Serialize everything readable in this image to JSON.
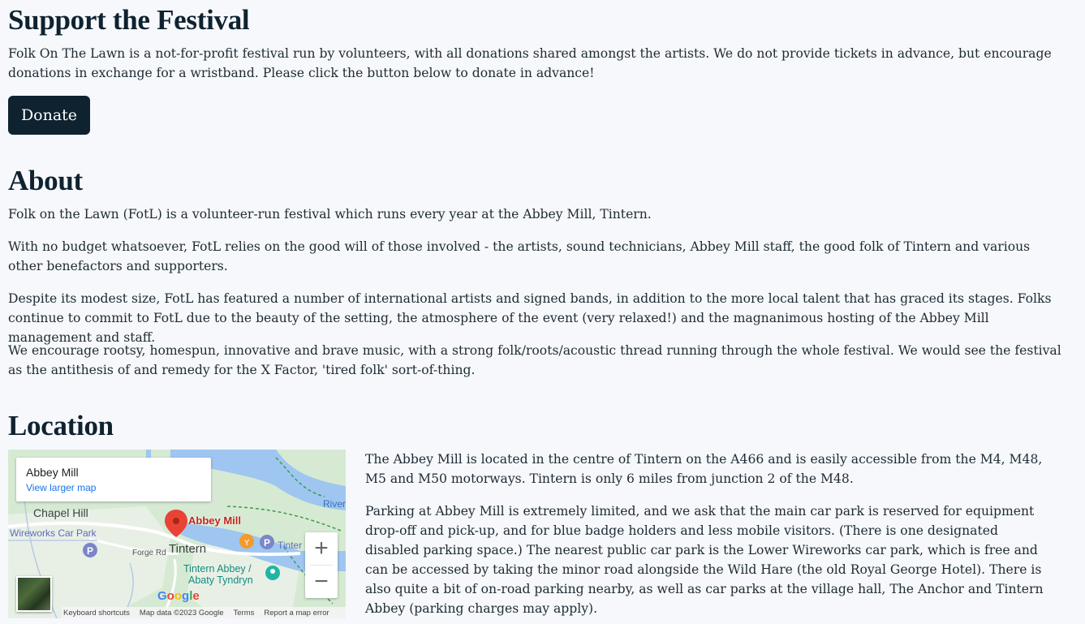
{
  "support": {
    "heading": "Support the Festival",
    "text": "Folk On The Lawn is a not-for-profit festival run by volunteers, with all donations shared amongst the artists. We do not provide tickets in advance, but encourage donations in exchange for a wristband. Please click the button below to donate in advance!",
    "donate_label": "Donate"
  },
  "about": {
    "heading": "About",
    "p1": "Folk on the Lawn (FotL) is a volunteer-run festival which runs every year at the Abbey Mill, Tintern.",
    "p2": "With no budget whatsoever, FotL relies on the good will of those involved - the artists, sound technicians, Abbey Mill staff, the good folk of Tintern and various other benefactors and supporters.",
    "p3": "Despite its modest size, FotL has featured a number of international artists and signed bands, in addition to the more local talent that has graced its stages. Folks continue to commit to FotL due to the beauty of the setting, the atmosphere of the event (very relaxed!) and the magnanimous hosting of the Abbey Mill management and staff.",
    "p4": "We encourage rootsy, homespun, innovative and brave music, with a strong folk/roots/acoustic thread running through the whole festival. We would see the festival as the antithesis of and remedy for the X Factor, 'tired folk' sort-of-thing."
  },
  "location": {
    "heading": "Location",
    "p1": "The Abbey Mill is located in the centre of Tintern on the A466 and is easily accessible from the M4, M48, M5 and M50 motorways. Tintern is only 6 miles from junction 2 of the M48.",
    "p2": "Parking at Abbey Mill is extremely limited, and we ask that the main car park is reserved for equipment drop-off and pick-up, and for blue badge holders and less mobile visitors. (There is one designated disabled parking space.) The nearest public car park is the Lower Wireworks car park, which is free and can be accessed by taking the minor road alongside the Wild Hare (the old Royal George Hotel). There is also quite a bit of on-road parking nearby, as well as car parks at the village hall, The Anchor and Tintern Abbey (parking charges may apply)."
  },
  "map": {
    "card_title": "Abbey Mill",
    "card_link": "View larger map",
    "labels": {
      "chapel_hill": "Chapel Hill",
      "wireworks": "Wireworks Car Park",
      "abbey_mill": "Abbey Mill",
      "forge_rd": "Forge Rd",
      "tintern": "Tintern",
      "tintern_abbey_1": "Tintern Abbey /",
      "tintern_abbey_2": "Abaty Tyndryn",
      "river": "River",
      "tinter": "Tinter"
    },
    "zoom_in": "+",
    "zoom_out": "−",
    "google": "Google",
    "attribution": {
      "shortcuts": "Keyboard shortcuts",
      "data": "Map data ©2023 Google",
      "terms": "Terms",
      "report": "Report a map error"
    },
    "colors": {
      "land": "#d6ead3",
      "water": "#9fc6f0",
      "road": "#ffffff",
      "pin": "#ea4335",
      "parking": "#7b86c9",
      "poi_orange": "#f29b2b",
      "poi_teal": "#1fb5a5"
    }
  }
}
